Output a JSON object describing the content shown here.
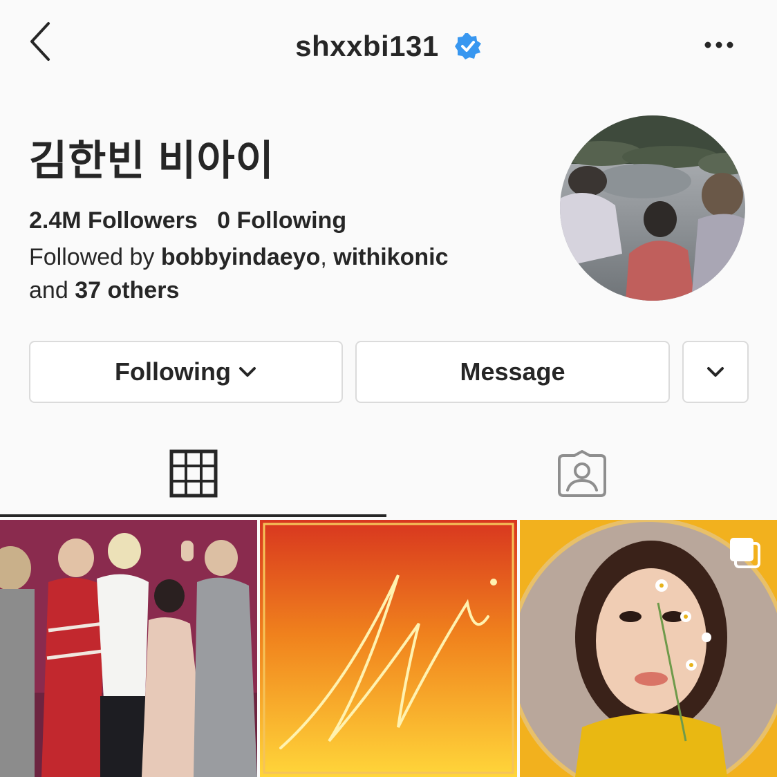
{
  "header": {
    "username": "shxxbi131",
    "back_icon": "chevron-left-icon",
    "verified_icon": "verified-badge-icon",
    "more_icon": "more-horizontal-icon"
  },
  "profile": {
    "full_name": "김한빈 비아이",
    "followers": "2.4M",
    "followers_label": "Followers",
    "following_count": "0",
    "following_label": "Following",
    "followed_by_prefix": "Followed by",
    "followed_by_user1": "bobbyindaeyo",
    "followed_by_user2": "withikonic",
    "followed_by_and": "and",
    "followed_by_others": "37 others"
  },
  "actions": {
    "following_label": "Following",
    "message_label": "Message",
    "suggest_icon": "chevron-down-icon"
  },
  "tabs": {
    "grid_icon": "grid-icon",
    "tagged_icon": "tagged-person-icon"
  },
  "posts": [
    {
      "description_icon": "group-photo"
    },
    {
      "description_icon": "album-art"
    },
    {
      "description_icon": "portrait",
      "multi_icon": "carousel-icon"
    }
  ],
  "colors": {
    "verified": "#3897f0",
    "text": "#262626",
    "border": "#dbdbdb",
    "background": "#fafafa"
  }
}
